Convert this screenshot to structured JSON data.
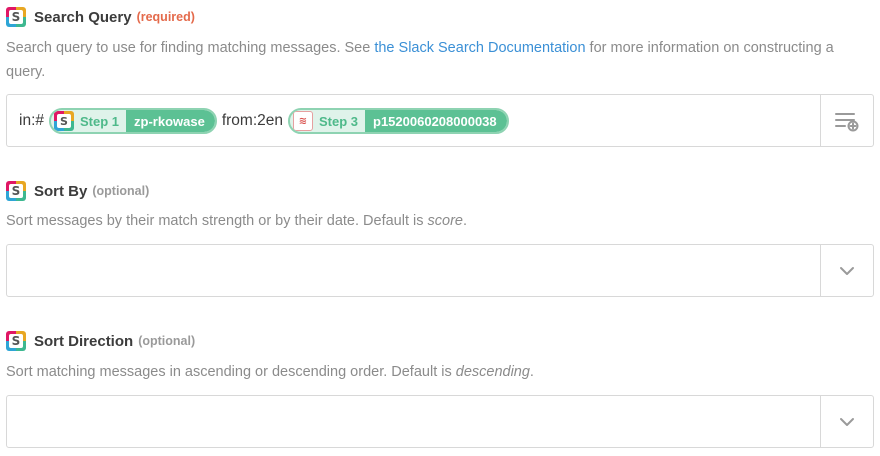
{
  "search_query": {
    "label": "Search Query",
    "tag": "(required)",
    "app_icon": "slack-icon",
    "help_prefix": "Search query to use for finding matching messages. See ",
    "help_link": "the Slack Search Documentation",
    "help_suffix": " for more information on constructing a query.",
    "query": {
      "text_before": "in:#",
      "pill1": {
        "app_icon": "slack-icon",
        "step": "Step 1",
        "value": "zp-rkowase"
      },
      "text_middle": "from:2en",
      "pill2": {
        "app_icon": "mail-icon",
        "step": "Step 3",
        "value": "p1520060208000038"
      }
    },
    "insert_icon": "insert-field-icon"
  },
  "sort_by": {
    "label": "Sort By",
    "tag": "(optional)",
    "app_icon": "slack-icon",
    "help_prefix": "Sort messages by their match strength or by their date. Default is ",
    "help_emphasis": "score",
    "help_suffix": ".",
    "value": "",
    "dropdown_icon": "chevron-down-icon"
  },
  "sort_direction": {
    "label": "Sort Direction",
    "tag": "(optional)",
    "app_icon": "slack-icon",
    "help_prefix": "Sort matching messages in ascending or descending order. Default is ",
    "help_emphasis": "descending",
    "help_suffix": ".",
    "value": "",
    "dropdown_icon": "chevron-down-icon"
  },
  "colors": {
    "required": "#e46a4b",
    "link": "#3b90d6",
    "pill_bg": "#dff3ea",
    "pill_accent": "#5cc194"
  }
}
